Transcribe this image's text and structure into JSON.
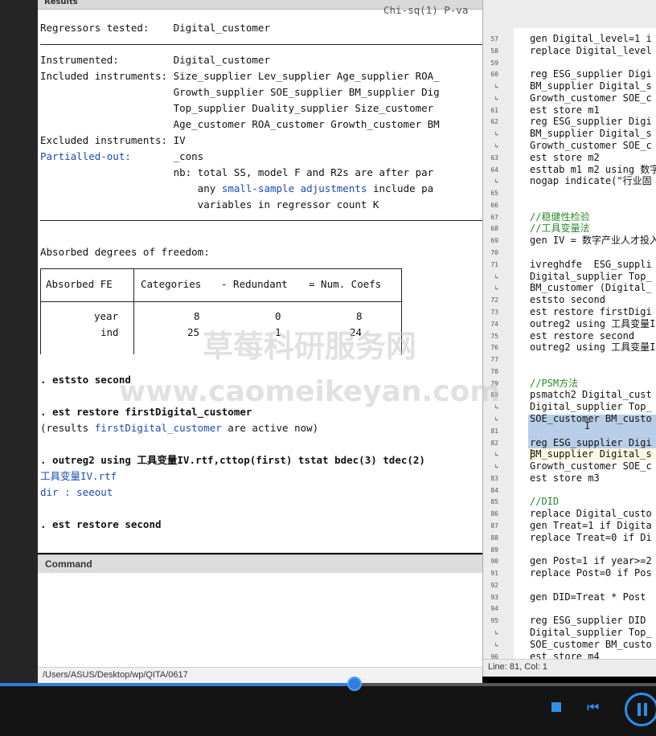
{
  "results": {
    "header": "Results",
    "top_cutoff": "Chi-sq(1) P-va",
    "lines": [
      {
        "label": "Regressors tested:",
        "value": "Digital_customer"
      },
      {
        "label": "Instrumented:",
        "value": "Digital_customer"
      },
      {
        "label": "Included instruments:",
        "value": "Size_supplier Lev_supplier Age_supplier ROA_"
      },
      {
        "label": "",
        "value": "Growth_supplier SOE_supplier BM_supplier Dig"
      },
      {
        "label": "",
        "value": "Top_supplier Duality_supplier Size_customer"
      },
      {
        "label": "",
        "value": "Age_customer ROA_customer Growth_customer BM"
      },
      {
        "label": "Excluded instruments:",
        "value": "IV"
      },
      {
        "label": "Partialled-out:",
        "value": "_cons"
      },
      {
        "label": "",
        "value": "nb: total SS, model F and R2s are after par"
      },
      {
        "label": "",
        "value": "    any small-sample adjustments include pa"
      },
      {
        "label": "",
        "value": "    variables in regressor count K"
      }
    ],
    "nb_link": "small-sample adjustments",
    "absorbed_title": "Absorbed degrees of freedom:",
    "table": {
      "headers": [
        "Absorbed FE",
        "Categories",
        "- Redundant",
        "= Num. Coefs"
      ],
      "rows": [
        {
          "fe": "year",
          "categories": "8",
          "redundant": "0",
          "coefs": "8"
        },
        {
          "fe": "ind",
          "categories": "25",
          "redundant": "1",
          "coefs": "24"
        }
      ]
    },
    "cmd1": ". eststo second",
    "cmd2": ". est restore firstDigital_customer",
    "note_prefix": "(results ",
    "note_link": "firstDigital_customer",
    "note_suffix": " are active now)",
    "cmd3": ". outreg2 using 工具变量IV.rtf,cttop(first) tstat bdec(3) tdec(2)",
    "file_link": "工具变量IV.rtf",
    "dir_prefix": "dir : ",
    "dir_link": "seeout",
    "cmd4": ". est restore second"
  },
  "command": {
    "header": "Command"
  },
  "status": {
    "path": "/Users/ASUS/Desktop/wp/QITA/0617"
  },
  "editor": {
    "footer": "Line: 81, Col: 1",
    "lines": [
      {
        "n": "57",
        "t": "gen Digital_level=1 i"
      },
      {
        "n": "58",
        "t": "replace Digital_level"
      },
      {
        "n": "59",
        "t": ""
      },
      {
        "n": "60",
        "t": "reg ESG_supplier Digi"
      },
      {
        "n": "↳",
        "t": "BM_supplier Digital_s"
      },
      {
        "n": "↳",
        "t": "Growth_customer SOE_c"
      },
      {
        "n": "61",
        "t": "est store m1"
      },
      {
        "n": "62",
        "t": "reg ESG_supplier Digi"
      },
      {
        "n": "↳",
        "t": "BM_supplier Digital_s"
      },
      {
        "n": "↳",
        "t": "Growth_customer SOE_c"
      },
      {
        "n": "63",
        "t": "est store m2"
      },
      {
        "n": "64",
        "t": "esttab m1 m2 using 数字"
      },
      {
        "n": "↳",
        "t": "nogap indicate(\"行业固"
      },
      {
        "n": "65",
        "t": ""
      },
      {
        "n": "66",
        "t": ""
      },
      {
        "n": "67",
        "t": "//稳健性检验",
        "c": "cmt"
      },
      {
        "n": "68",
        "t": "//工具变量法",
        "c": "cmt"
      },
      {
        "n": "69",
        "t": "gen IV = 数字产业人才投入"
      },
      {
        "n": "70",
        "t": ""
      },
      {
        "n": "71",
        "t": "ivreghdfe  ESG_suppli"
      },
      {
        "n": "↳",
        "t": "Digital_supplier Top_"
      },
      {
        "n": "↳",
        "t": "BM_customer (Digital_"
      },
      {
        "n": "72",
        "t": "eststo second"
      },
      {
        "n": "73",
        "t": "est restore firstDigi"
      },
      {
        "n": "74",
        "t": "outreg2 using 工具变量I"
      },
      {
        "n": "75",
        "t": "est restore second"
      },
      {
        "n": "76",
        "t": "outreg2 using 工具变量I"
      },
      {
        "n": "77",
        "t": ""
      },
      {
        "n": "78",
        "t": ""
      },
      {
        "n": "79",
        "t": "//PSM方法",
        "c": "cmt"
      },
      {
        "n": "80",
        "t": "psmatch2 Digital_cust"
      },
      {
        "n": "↳",
        "t": "Digital_supplier Top_"
      },
      {
        "n": "↳",
        "t": "SOE_customer BM_custo"
      },
      {
        "n": "81",
        "t": ""
      },
      {
        "n": "82",
        "t": "reg ESG_supplier Digi"
      },
      {
        "n": "↳",
        "t": "BM_supplier Digital_s"
      },
      {
        "n": "↳",
        "t": "Growth_customer SOE_c"
      },
      {
        "n": "83",
        "t": "est store m3"
      },
      {
        "n": "84",
        "t": ""
      },
      {
        "n": "85",
        "t": "//DID",
        "c": "cmt"
      },
      {
        "n": "86",
        "t": "replace Digital_custo"
      },
      {
        "n": "87",
        "t": "gen Treat=1 if Digita"
      },
      {
        "n": "88",
        "t": "replace Treat=0 if Di"
      },
      {
        "n": "89",
        "t": ""
      },
      {
        "n": "90",
        "t": "gen Post=1 if year>=2"
      },
      {
        "n": "91",
        "t": "replace Post=0 if Pos"
      },
      {
        "n": "92",
        "t": ""
      },
      {
        "n": "93",
        "t": "gen DID=Treat * Post"
      },
      {
        "n": "94",
        "t": ""
      },
      {
        "n": "95",
        "t": "reg ESG_supplier DID"
      },
      {
        "n": "↳",
        "t": "Digital_supplier Top_"
      },
      {
        "n": "↳",
        "t": "SOE_customer BM_custo"
      },
      {
        "n": "96",
        "t": "est store m4"
      }
    ]
  },
  "watermark": {
    "cn": "草莓科研服务网",
    "url": "www.caomeikeyan.com"
  },
  "player": {
    "progress_percent": 54,
    "accent": "#2f7fe0"
  },
  "icons": [
    "stop-icon",
    "previous-icon",
    "pause-icon",
    "text-cursor-icon"
  ]
}
